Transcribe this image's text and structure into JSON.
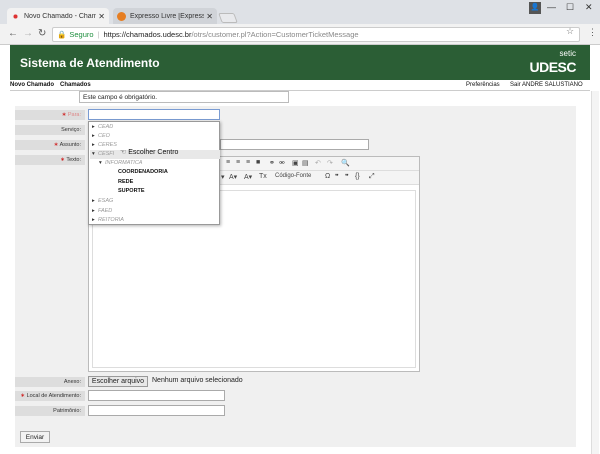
{
  "browser": {
    "tabs": [
      {
        "title": "Novo Chamado - Chama",
        "active": true
      },
      {
        "title": "Expresso Livre [Expresso",
        "active": false
      }
    ],
    "secure_label": "Seguro",
    "url_host": "https://chamados.udesc.br",
    "url_path": "/otrs/customer.pl?Action=CustomerTicketMessage"
  },
  "header": {
    "title": "Sistema de Atendimento",
    "setic": "setic",
    "udesc": "UDESC"
  },
  "nav": {
    "left": [
      "Novo Chamado",
      "Chamados"
    ],
    "right": [
      "Preferências",
      "Sair ANDRE SALUSTIANO"
    ]
  },
  "tooltip": "Este campo é obrigatório.",
  "form": {
    "labels": {
      "para": "Para:",
      "servico": "Serviço:",
      "assunto": "Assunto:",
      "texto": "Texto:",
      "anexo": "Anexo:",
      "local": "Local de Atendimento:",
      "patrimonio": "Patrimônio:"
    },
    "anexo_button": "Escolher arquivo",
    "anexo_status": "Nenhum arquivo selecionado",
    "submit": "Enviar",
    "codigo_fonte": "Código-Fonte"
  },
  "tree": {
    "hover_tooltip": "Escolher Centro",
    "items": [
      "CEAD",
      "CEO",
      "CERES",
      "CESFI",
      "INFORMATICA",
      "COORDENADORIA",
      "REDE",
      "SUPORTE",
      "ESAG",
      "FAED",
      "REITORIA"
    ]
  }
}
